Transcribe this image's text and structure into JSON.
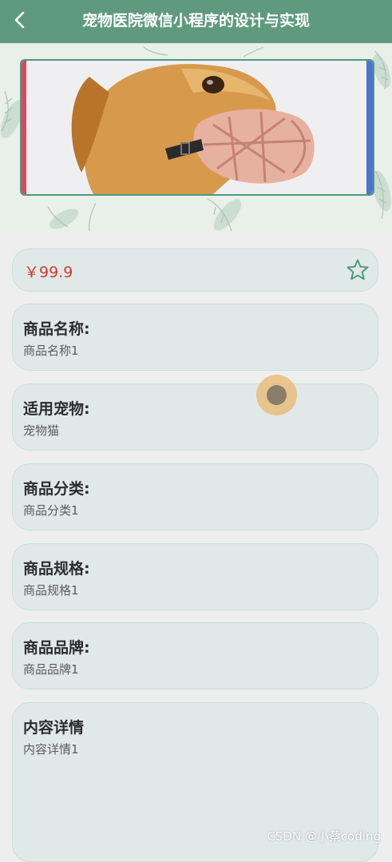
{
  "header": {
    "title": "宠物医院微信小程序的设计与实现",
    "back_icon": "chevron-left-icon"
  },
  "product": {
    "price": "￥99.9",
    "favorite_icon": "star-outline-icon",
    "fields": [
      {
        "label": "商品名称:",
        "value": "商品名称1"
      },
      {
        "label": "适用宠物:",
        "value": "宠物猫"
      },
      {
        "label": "商品分类:",
        "value": "商品分类1"
      },
      {
        "label": "商品规格:",
        "value": "商品规格1"
      },
      {
        "label": "商品品牌:",
        "value": "商品品牌1"
      }
    ],
    "detail": {
      "label": "内容详情",
      "value": "内容详情1"
    }
  },
  "watermark": "CSDN @小蔡coding",
  "colors": {
    "header_bg": "#5f9a7e",
    "price": "#c8402d",
    "card_bg": "#e1e8e8",
    "card_border": "#c6e0da"
  }
}
